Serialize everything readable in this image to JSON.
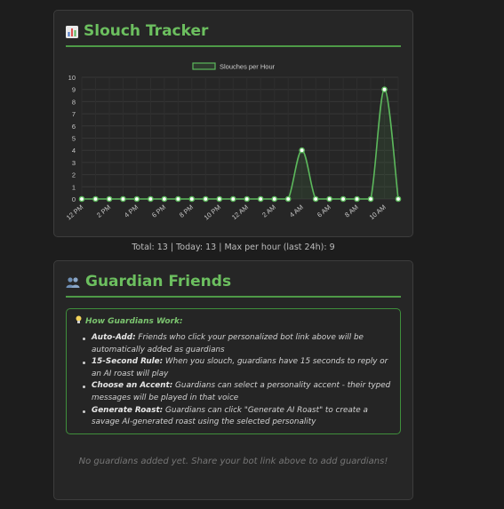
{
  "tracker": {
    "title": "Slouch Tracker",
    "icon": "bar-chart-icon",
    "stats": {
      "total_label": "Total: 13",
      "today_label": "Today: 13",
      "max_label": "Max per hour (last 24h): 9",
      "separator": " | "
    }
  },
  "chart_data": {
    "type": "line",
    "legend": "Slouches per Hour",
    "ylim": [
      0,
      10
    ],
    "yticks": [
      "0",
      "1",
      "2",
      "3",
      "4",
      "5",
      "6",
      "7",
      "8",
      "9",
      "10"
    ],
    "xtick_labels": [
      "12 PM",
      "2 PM",
      "4 PM",
      "6 PM",
      "8 PM",
      "10 PM",
      "12 AM",
      "2 AM",
      "4 AM",
      "6 AM",
      "8 AM",
      "10 AM"
    ],
    "x": [
      "12 PM",
      "1 PM",
      "2 PM",
      "3 PM",
      "4 PM",
      "5 PM",
      "6 PM",
      "7 PM",
      "8 PM",
      "9 PM",
      "10 PM",
      "11 PM",
      "12 AM",
      "1 AM",
      "2 AM",
      "3 AM",
      "4 AM",
      "5 AM",
      "6 AM",
      "7 AM",
      "8 AM",
      "9 AM",
      "10 AM",
      "11 AM"
    ],
    "values": [
      0,
      0,
      0,
      0,
      0,
      0,
      0,
      0,
      0,
      0,
      0,
      0,
      0,
      0,
      0,
      0,
      4,
      0,
      0,
      0,
      0,
      0,
      9,
      0
    ],
    "grid": true,
    "legend_position": "top-center",
    "line_color": "#5cb85c"
  },
  "guardians": {
    "title": "Guardian Friends",
    "icon": "people-icon",
    "info_title": "How Guardians Work:",
    "items": [
      {
        "label": "Auto-Add:",
        "text": " Friends who click your personalized bot link above will be automatically added as guardians"
      },
      {
        "label": "15-Second Rule:",
        "text": " When you slouch, guardians have 15 seconds to reply or an AI roast will play"
      },
      {
        "label": "Choose an Accent:",
        "text": " Guardians can select a personality accent - their typed messages will be played in that voice"
      },
      {
        "label": "Generate Roast:",
        "text": " Guardians can click \"Generate AI Roast\" to create a savage AI-generated roast using the selected personality"
      }
    ],
    "empty_message": "No guardians added yet. Share your bot link above to add guardians!"
  }
}
